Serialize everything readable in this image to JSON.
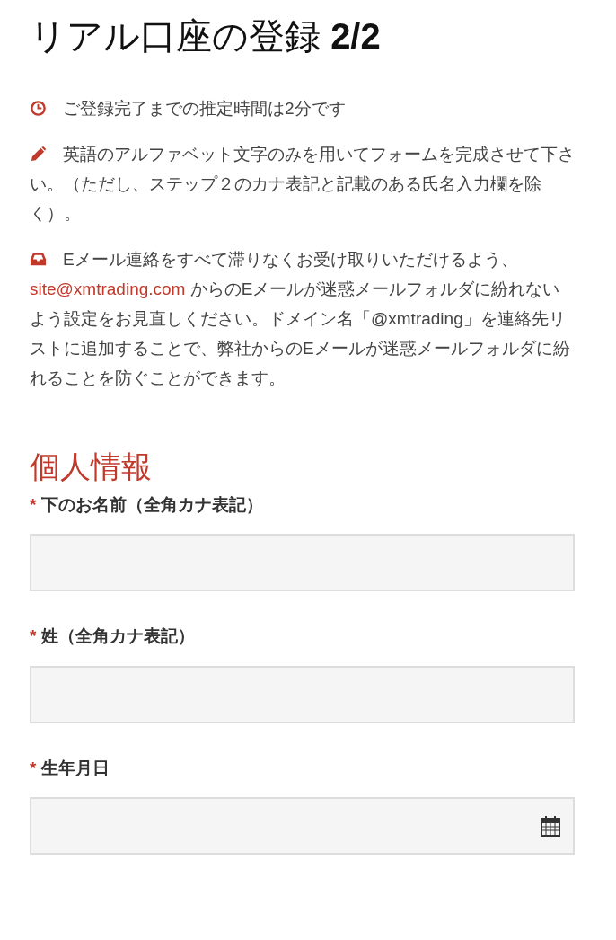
{
  "title": "リアル口座の登録 **2/2**",
  "notes": [
    {
      "kind": "clock",
      "text": "ご登録完了までの推定時間は2分です"
    },
    {
      "kind": "pencil",
      "text": "英語のアルファベット文字のみを用いてフォームを完成させて下さい。（ただし、ステップ２のカナ表記と記載のある氏名入力欄を除く）。"
    },
    {
      "kind": "inbox",
      "text": "Eメール連絡をすべて滞りなくお受け取りいただけるよう、",
      "link": "site@xmtrading.com",
      "text_after": " からのEメールが迷惑メールフォルダに紛れないよう設定をお見直しください。ドメイン名「@xmtrading」を連絡先リストに追加することで、弊社からのEメールが迷惑メールフォルダに紛れることを防ぐことができます。"
    }
  ],
  "section": {
    "title": "個人情報",
    "fields": [
      {
        "kind": "text",
        "required_mark": "*",
        "label": "下のお名前（全角カナ表記）"
      },
      {
        "kind": "text",
        "required_mark": "*",
        "label": "姓（全角カナ表記）"
      },
      {
        "kind": "date",
        "required_mark": "*",
        "label": "生年月日"
      }
    ]
  }
}
